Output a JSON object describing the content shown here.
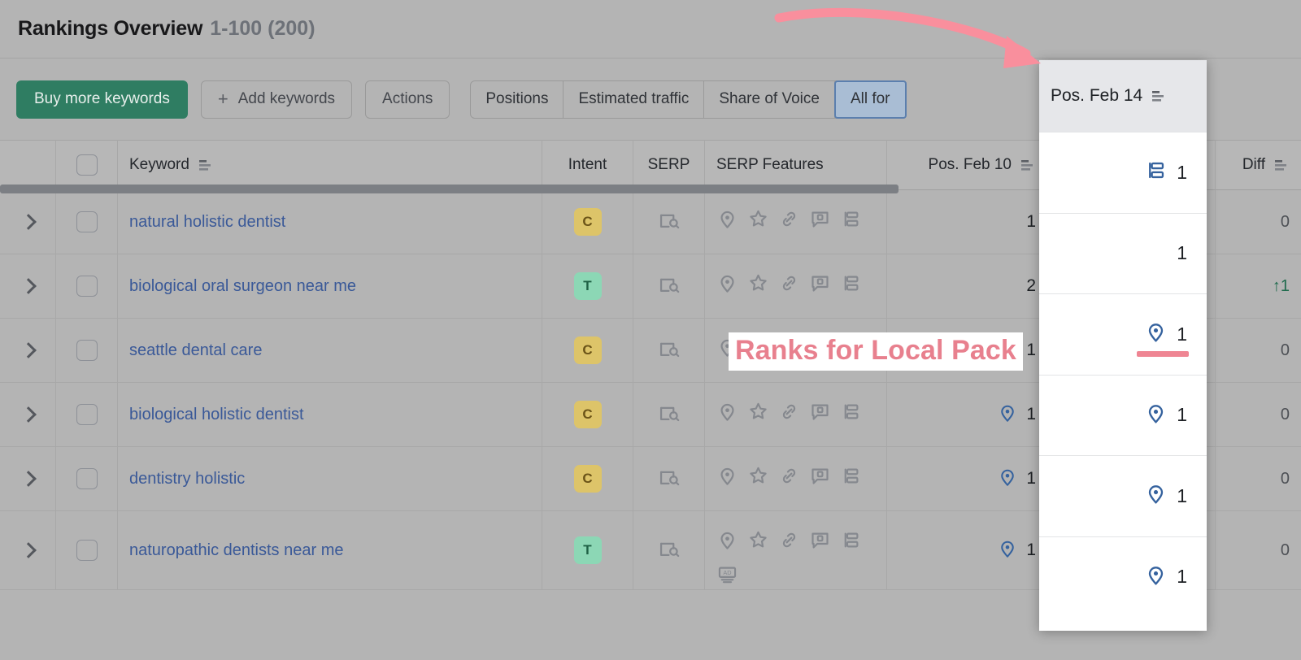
{
  "header": {
    "title": "Rankings Overview",
    "range": "1-100 (200)"
  },
  "toolbar": {
    "buy_label": "Buy more keywords",
    "add_label": "Add keywords",
    "add_icon": "plus-icon",
    "actions_label": "Actions",
    "tabs": [
      {
        "label": "Positions",
        "active": false
      },
      {
        "label": "Estimated traffic",
        "active": false
      },
      {
        "label": "Share of Voice",
        "active": false
      },
      {
        "label": "All for",
        "active": true
      }
    ]
  },
  "table": {
    "columns": {
      "keyword": "Keyword",
      "intent": "Intent",
      "serp": "SERP",
      "serp_features": "SERP Features",
      "pos_feb10": "Pos. Feb 10",
      "diff": "Diff"
    },
    "rows": [
      {
        "keyword": "natural holistic dentist",
        "intent": "C",
        "serp_icon": "serp-preview-icon",
        "features": [
          "local-pack-icon",
          "reviews-star-icon",
          "link-icon",
          "questions-icon",
          "sitelinks-icon"
        ],
        "pos_feb10": "1",
        "pos_feb10_icon": "",
        "diff": "0",
        "diff_dir": "none"
      },
      {
        "keyword": "biological oral surgeon near me",
        "intent": "T",
        "serp_icon": "serp-preview-icon",
        "features": [
          "local-pack-icon",
          "reviews-star-icon",
          "link-icon",
          "questions-icon",
          "sitelinks-icon"
        ],
        "pos_feb10": "2",
        "pos_feb10_icon": "",
        "diff": "1",
        "diff_dir": "up"
      },
      {
        "keyword": "seattle dental care",
        "intent": "C",
        "serp_icon": "serp-preview-icon",
        "features": [
          "local-pack-icon",
          "reviews-star-icon",
          "link-icon"
        ],
        "pos_feb10": "1",
        "pos_feb10_icon": "local-pack-icon",
        "diff": "0",
        "diff_dir": "none"
      },
      {
        "keyword": "biological holistic dentist",
        "intent": "C",
        "serp_icon": "serp-preview-icon",
        "features": [
          "local-pack-icon",
          "reviews-star-icon",
          "link-icon",
          "questions-icon",
          "sitelinks-icon"
        ],
        "pos_feb10": "1",
        "pos_feb10_icon": "local-pack-icon",
        "diff": "0",
        "diff_dir": "none"
      },
      {
        "keyword": "dentistry holistic",
        "intent": "C",
        "serp_icon": "serp-preview-icon",
        "features": [
          "local-pack-icon",
          "reviews-star-icon",
          "link-icon",
          "questions-icon",
          "sitelinks-icon"
        ],
        "pos_feb10": "1",
        "pos_feb10_icon": "local-pack-icon",
        "diff": "0",
        "diff_dir": "none"
      },
      {
        "keyword": "naturopathic dentists near me",
        "intent": "T",
        "serp_icon": "serp-preview-icon",
        "features": [
          "local-pack-icon",
          "reviews-star-icon",
          "link-icon",
          "questions-icon",
          "sitelinks-icon",
          "ads-icon"
        ],
        "pos_feb10": "1",
        "pos_feb10_icon": "local-pack-icon",
        "diff": "0",
        "diff_dir": "none"
      }
    ]
  },
  "overlay": {
    "title": "Pos. Feb 14",
    "rows": [
      {
        "icon": "sitelinks-icon",
        "value": "1",
        "highlighted": false
      },
      {
        "icon": "",
        "value": "1",
        "highlighted": false
      },
      {
        "icon": "local-pack-icon",
        "value": "1",
        "highlighted": true
      },
      {
        "icon": "local-pack-icon",
        "value": "1",
        "highlighted": false
      },
      {
        "icon": "local-pack-icon",
        "value": "1",
        "highlighted": false
      },
      {
        "icon": "local-pack-icon",
        "value": "1",
        "highlighted": false
      }
    ]
  },
  "annotations": {
    "callout_text": "Ranks for Local Pack",
    "arrow": "curved-arrow-icon",
    "accent_color": "#ef8593"
  }
}
